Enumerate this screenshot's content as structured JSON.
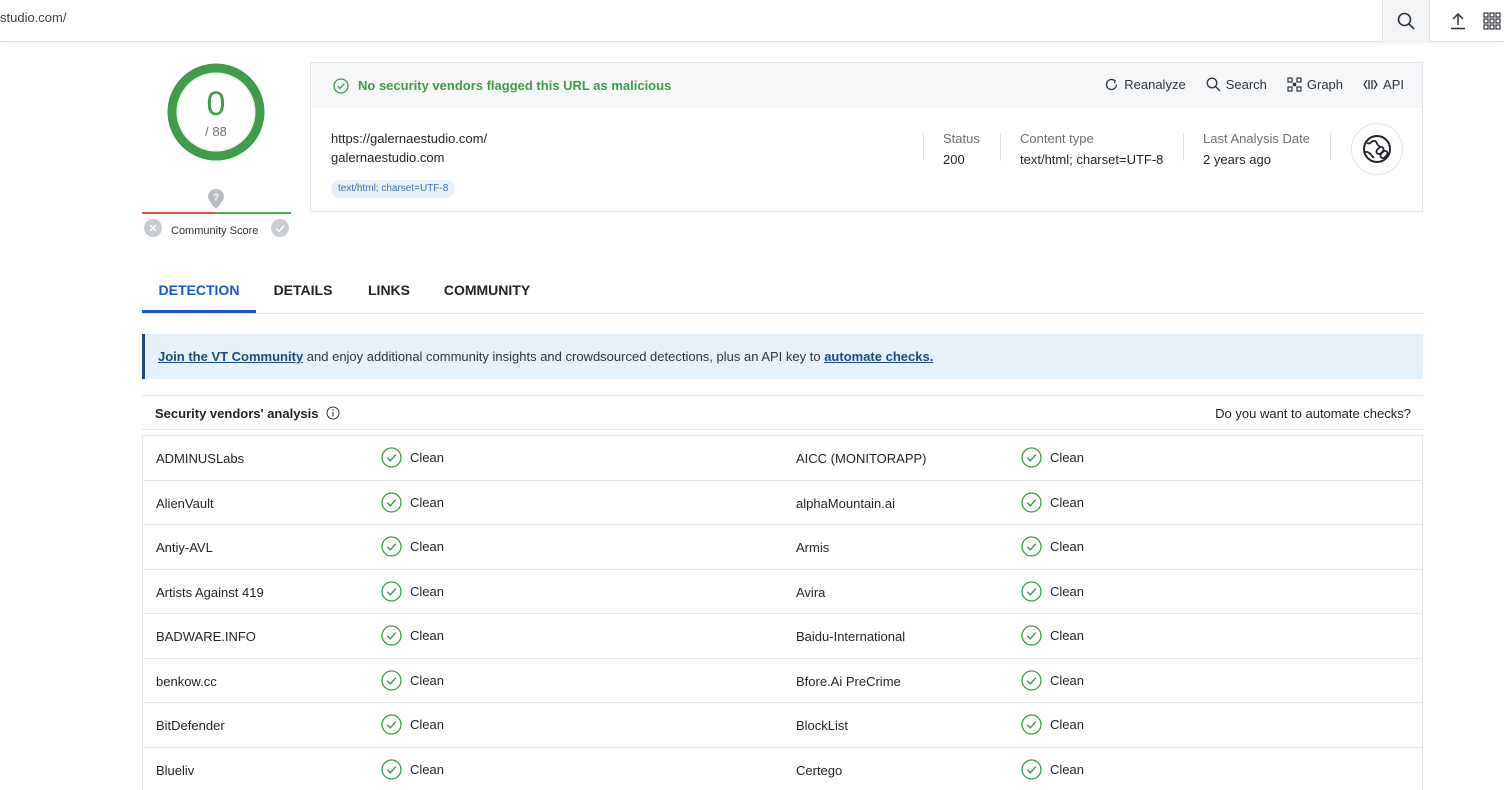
{
  "browser": {
    "url_fragment": "studio.com/",
    "icons": [
      "search-icon",
      "upload-icon",
      "apps-grid-icon"
    ]
  },
  "score": {
    "detections": "0",
    "total": "/ 88",
    "community_label": "Community Score",
    "ring_color": "#3f9c4a"
  },
  "summary": {
    "flag_text": "No security vendors flagged this URL as malicious",
    "actions": {
      "reanalyze": "Reanalyze",
      "search": "Search",
      "graph": "Graph",
      "api": "API"
    },
    "url": "https://galernaestudio.com/",
    "domain": "galernaestudio.com",
    "tag": "text/html; charset=UTF-8",
    "status_label": "Status",
    "status_value": "200",
    "content_type_label": "Content type",
    "content_type_value": "text/html; charset=UTF-8",
    "last_analysis_label": "Last Analysis Date",
    "last_analysis_value": "2 years ago"
  },
  "tabs": [
    "DETECTION",
    "DETAILS",
    "LINKS",
    "COMMUNITY"
  ],
  "banner": {
    "link1": "Join the VT Community",
    "middle": " and enjoy additional community insights and crowdsourced detections, plus an API key to ",
    "link2": "automate checks."
  },
  "vendors": {
    "title": "Security vendors' analysis",
    "automate": "Do you want to automate checks?",
    "rows": [
      {
        "left": "ADMINUSLabs",
        "left_result": "Clean",
        "right": "AICC (MONITORAPP)",
        "right_result": "Clean"
      },
      {
        "left": "AlienVault",
        "left_result": "Clean",
        "right": "alphaMountain.ai",
        "right_result": "Clean"
      },
      {
        "left": "Antiy-AVL",
        "left_result": "Clean",
        "right": "Armis",
        "right_result": "Clean"
      },
      {
        "left": "Artists Against 419",
        "left_result": "Clean",
        "right": "Avira",
        "right_result": "Clean"
      },
      {
        "left": "BADWARE.INFO",
        "left_result": "Clean",
        "right": "Baidu-International",
        "right_result": "Clean"
      },
      {
        "left": "benkow.cc",
        "left_result": "Clean",
        "right": "Bfore.Ai PreCrime",
        "right_result": "Clean"
      },
      {
        "left": "BitDefender",
        "left_result": "Clean",
        "right": "BlockList",
        "right_result": "Clean"
      },
      {
        "left": "Blueliv",
        "left_result": "Clean",
        "right": "Certego",
        "right_result": "Clean"
      }
    ]
  }
}
